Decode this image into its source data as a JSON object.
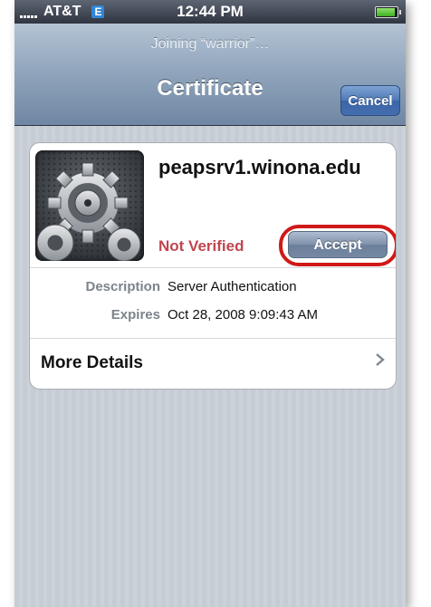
{
  "status_bar": {
    "carrier": "AT&T",
    "network": "E",
    "time": "12:44 PM"
  },
  "nav": {
    "prompt": "Joining “warrior”…",
    "title": "Certificate",
    "cancel_label": "Cancel"
  },
  "certificate": {
    "hostname": "peapsrv1.winona.edu",
    "status": "Not Verified",
    "accept_label": "Accept",
    "icon": "settings-gears-icon",
    "details": [
      {
        "label": "Description",
        "value": "Server Authentication"
      },
      {
        "label": "Expires",
        "value": "Oct 28, 2008 9:09:43 AM"
      }
    ],
    "more_details_label": "More Details"
  },
  "colors": {
    "status_not_verified": "#c0464f",
    "highlight_ring": "#d01818",
    "cancel_button": "#4e78b5"
  }
}
